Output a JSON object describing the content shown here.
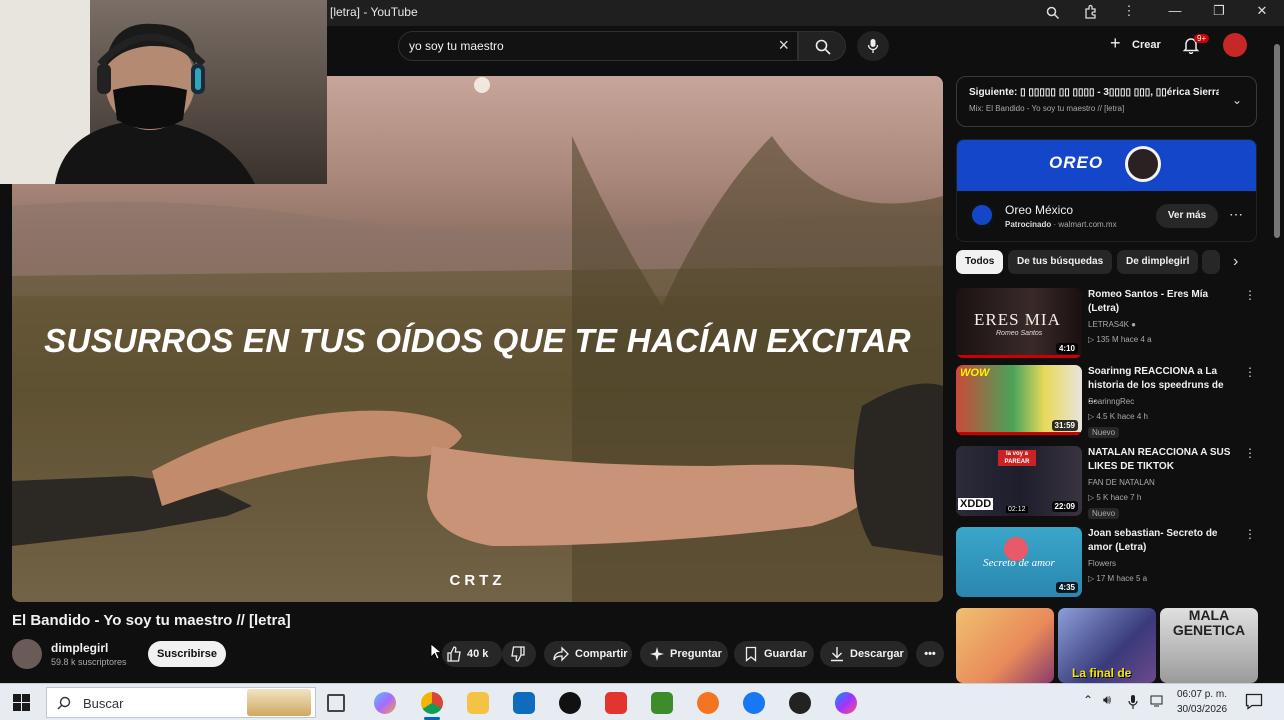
{
  "window": {
    "title": "[letra] - YouTube"
  },
  "search": {
    "query": "yo soy tu maestro"
  },
  "topbar": {
    "create_label": "Crear",
    "notif_badge": "9+"
  },
  "video": {
    "lyric": "SUSURROS EN TUS OÍDOS QUE TE HACÍAN EXCITAR",
    "watermark": "CRTZ",
    "title": "El Bandido - Yo soy tu maestro // [letra]",
    "channel": "dimplegirl",
    "subscribers": "59.8 k suscriptores",
    "subscribe_label": "Suscribirse",
    "likes": "40 k",
    "share_label": "Compartir",
    "ask_label": "Preguntar",
    "save_label": "Guardar",
    "download_label": "Descargar"
  },
  "up_next": {
    "line1": "Siguiente: ▯ ▯▯▯▯▯ ▯▯ ▯▯▯▯ - 3▯▯▯▯ ▯▯▯, ▯▯érica Sierra & ...",
    "line2": "Mix: El Bandido - Yo soy tu maestro // [letra]"
  },
  "ad": {
    "brand_banner": "OREO",
    "advertiser": "Oreo México",
    "sponsored": "Patrocinado",
    "domain": "walmart.com.mx",
    "cta": "Ver más"
  },
  "chips": [
    "Todos",
    "De tus búsquedas",
    "De dimplegirl"
  ],
  "recommendations": [
    {
      "title": "Romeo Santos - Eres Mía (Letra)",
      "channel": "LETRAS4K",
      "meta": "▷ 135 M  hace 4 a",
      "duration": "4:10",
      "thumb_text": "ERES MIA",
      "thumb_sub": "Romeo Santos",
      "new": ""
    },
    {
      "title": "Soarinng REACCIONA a La historia de los speedruns de ...",
      "channel": "SoarinngRec",
      "meta": "▷ 4.5 K  hace 4 h",
      "duration": "31:59",
      "thumb_text": "WOW",
      "thumb_sub": "",
      "new": "Nuevo"
    },
    {
      "title": "NATALAN REACCIONA A SUS LIKES DE TIKTOK",
      "channel": "FAN DE NATALAN",
      "meta": "▷ 5 K  hace 7 h",
      "duration": "22:09",
      "thumb_text": "la voy a PAREAR",
      "thumb_sub": "XDDD",
      "new": "Nuevo"
    },
    {
      "title": "Joan sebastian- Secreto de amor (Letra)",
      "channel": "Flowers",
      "meta": "▷ 17 M  hace 5 a",
      "duration": "4:35",
      "thumb_text": "Secreto de amor",
      "thumb_sub": "",
      "new": ""
    }
  ],
  "shorts": [
    {
      "text": ""
    },
    {
      "text": "La final de"
    },
    {
      "text": "MALA GENETICA"
    }
  ],
  "taskbar": {
    "search_placeholder": "Buscar",
    "time": "06:07 p. m.",
    "date": "30/03/2026"
  },
  "colors": {
    "accent": "#cc0000",
    "background": "#0f0f0f",
    "chip_active": "#f1f1f1",
    "oreo_blue": "#1446c9"
  }
}
